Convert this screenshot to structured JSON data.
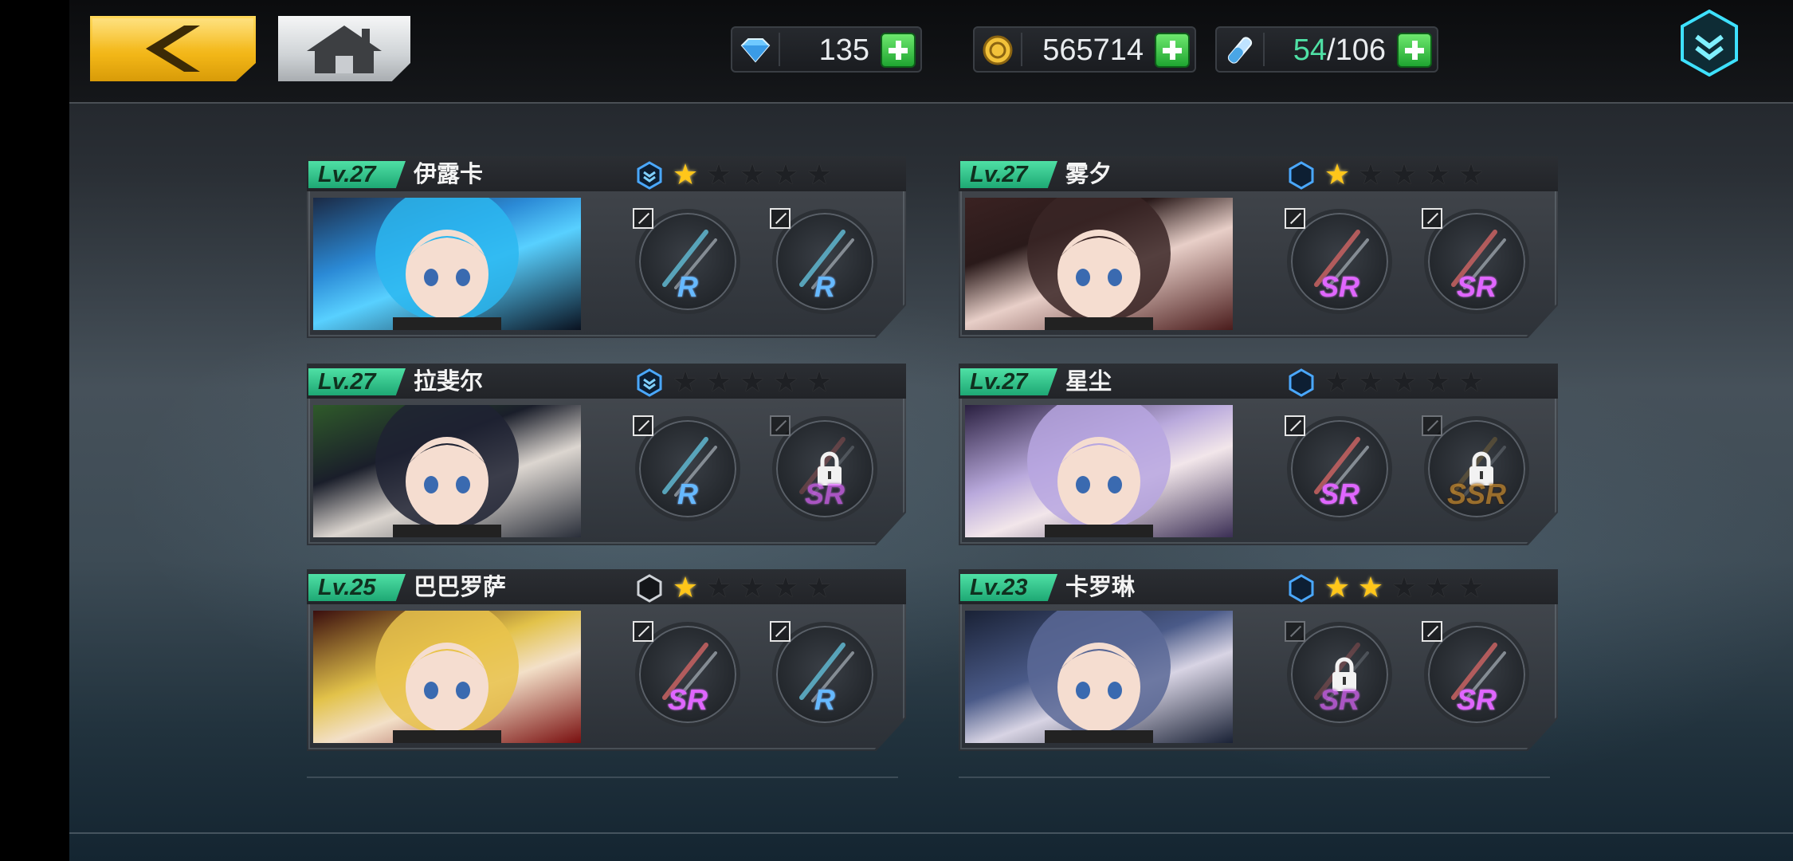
{
  "topbar": {
    "back_icon": "back-arrow-icon",
    "home_icon": "home-icon",
    "resources": [
      {
        "id": "diamonds",
        "icon": "diamond-icon",
        "value": "135"
      },
      {
        "id": "gold",
        "icon": "gold-coin-icon",
        "value": "565714"
      },
      {
        "id": "stamina",
        "icon": "stamina-vial-icon",
        "value_current": "54",
        "value_max": "/106"
      }
    ],
    "menu_icon": "chevron-down-menu-icon"
  },
  "colors": {
    "level_badge": "#1ea874",
    "star_on": "#ffc61a",
    "rarity_R": "#66b9ff",
    "rarity_SR": "#e066ff",
    "rarity_SSR": "#c98a2b",
    "stamina_current": "#4fe0a5"
  },
  "characters": [
    {
      "level": "Lv.27",
      "name": "伊露卡",
      "rank_icon": "rank-chevron-icon",
      "stars": 1,
      "equipment": [
        {
          "rarity": "R",
          "locked": false
        },
        {
          "rarity": "R",
          "locked": false
        }
      ]
    },
    {
      "level": "Lv.27",
      "name": "雾夕",
      "rank_icon": "rank-hexagon-blue-icon",
      "stars": 1,
      "equipment": [
        {
          "rarity": "SR",
          "locked": false
        },
        {
          "rarity": "SR",
          "locked": false
        }
      ]
    },
    {
      "level": "Lv.27",
      "name": "拉斐尔",
      "rank_icon": "rank-chevron-icon",
      "stars": 0,
      "equipment": [
        {
          "rarity": "R",
          "locked": false
        },
        {
          "rarity": "SR",
          "locked": true
        }
      ]
    },
    {
      "level": "Lv.27",
      "name": "星尘",
      "rank_icon": "rank-hexagon-blue-icon",
      "stars": 0,
      "equipment": [
        {
          "rarity": "SR",
          "locked": false
        },
        {
          "rarity": "SSR",
          "locked": true
        }
      ]
    },
    {
      "level": "Lv.25",
      "name": "巴巴罗萨",
      "rank_icon": "rank-hexagon-dark-icon",
      "stars": 1,
      "equipment": [
        {
          "rarity": "SR",
          "locked": false
        },
        {
          "rarity": "R",
          "locked": false
        }
      ]
    },
    {
      "level": "Lv.23",
      "name": "卡罗琳",
      "rank_icon": "rank-hexagon-blue-icon",
      "stars": 2,
      "equipment": [
        {
          "rarity": "SR",
          "locked": true
        },
        {
          "rarity": "SR",
          "locked": false
        }
      ]
    }
  ]
}
